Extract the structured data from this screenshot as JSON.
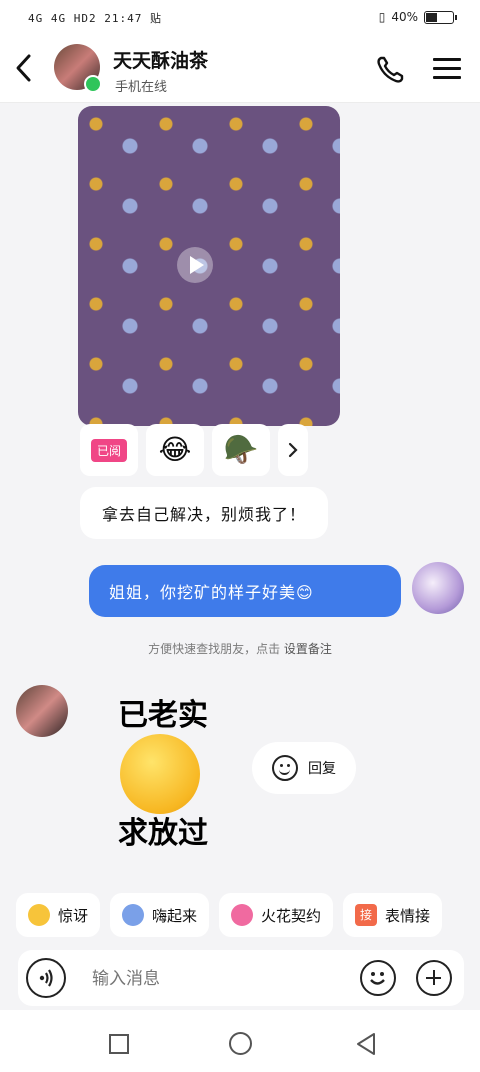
{
  "status_bar": {
    "left": "4G 4G HD2 21:47 贴",
    "battery": "40%"
  },
  "header": {
    "title": "天天酥油茶",
    "subtitle": "手机在线"
  },
  "video_message": {
    "read_badge": "已阅",
    "reaction_1": "😂",
    "reaction_2": "🪖"
  },
  "messages": {
    "incoming_text": "拿去自己解决，别烦我了！",
    "outgoing_text": "姐姐，你挖矿的样子好美😊",
    "hint_prefix": "方便快速查找朋友，点击",
    "hint_link": "设置备注",
    "sticker_top": "已老实",
    "sticker_bottom": "求放过",
    "reply_label": "回复"
  },
  "quick_actions": [
    {
      "label": "惊讶",
      "color": "#f7c43a"
    },
    {
      "label": "嗨起来",
      "color": "#7aa0e8"
    },
    {
      "label": "火花契约",
      "color": "#f06aa0"
    },
    {
      "label": "表情接",
      "badge": "接",
      "color": "#f26a4a"
    }
  ],
  "input": {
    "placeholder": "输入消息"
  },
  "icons": {
    "back": "chevron-left",
    "phone": "phone",
    "menu": "hamburger",
    "play": "play",
    "voice": "voice-wave",
    "emoji": "smile",
    "plus": "plus"
  }
}
